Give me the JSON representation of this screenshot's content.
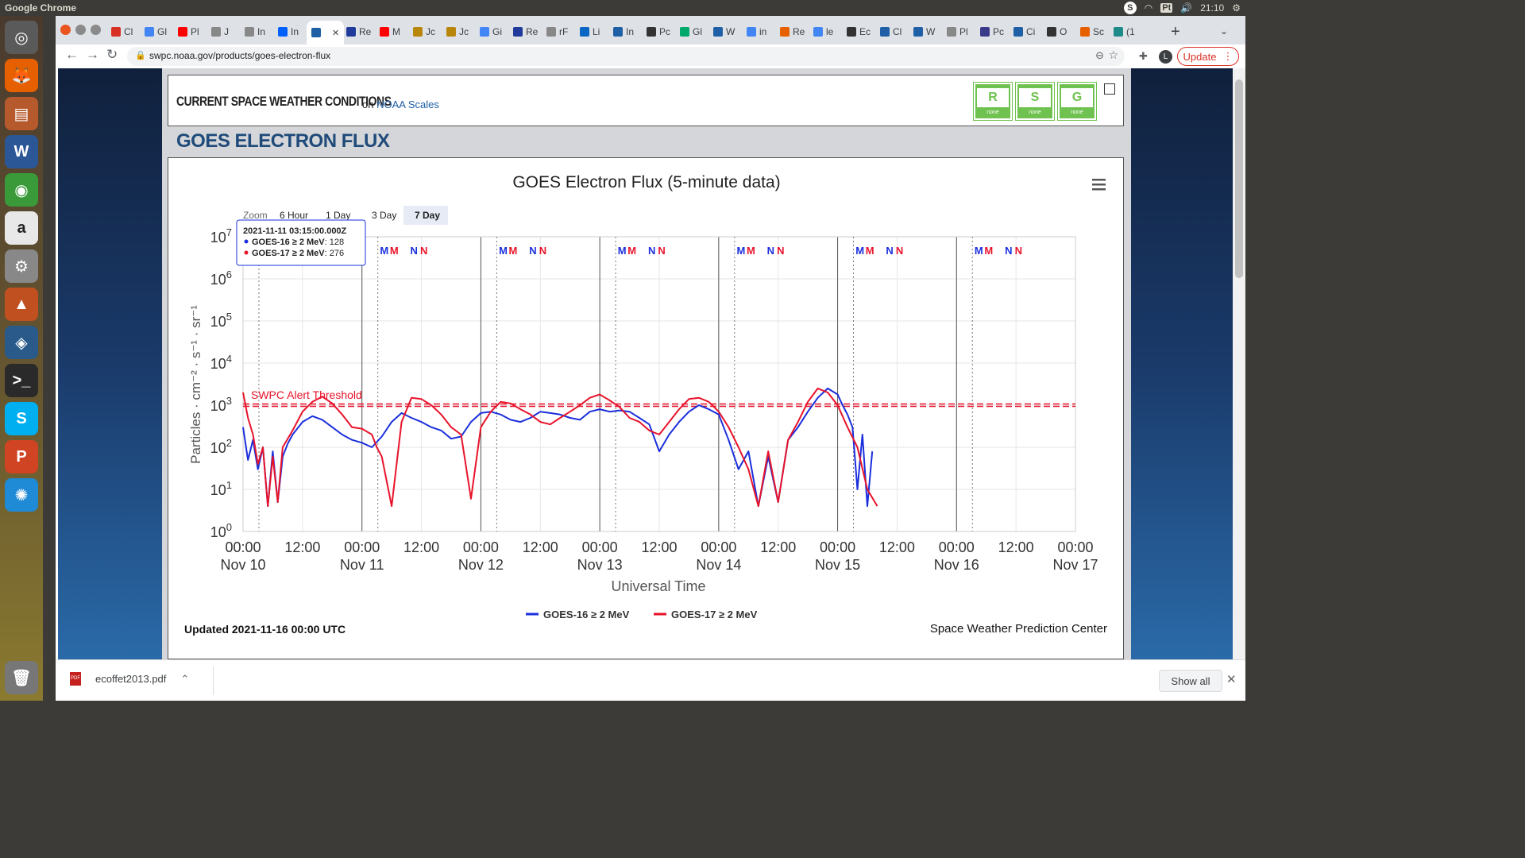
{
  "os": {
    "app_title": "Google Chrome",
    "tray": {
      "skype": "S",
      "keyboard": "Pt",
      "time": "21:10"
    }
  },
  "launcher": [
    {
      "name": "dash-icon",
      "color": "#5a5a5a",
      "glyph": "◎"
    },
    {
      "name": "firefox-icon",
      "color": "#e66000",
      "glyph": "🦊"
    },
    {
      "name": "files-icon",
      "color": "#b65a2e",
      "glyph": "▤"
    },
    {
      "name": "word-icon",
      "color": "#2b5797",
      "glyph": "W"
    },
    {
      "name": "chrome-icon",
      "color": "#3a9a3a",
      "glyph": "◉"
    },
    {
      "name": "amazon-icon",
      "color": "#e8e8e8",
      "glyph": "a"
    },
    {
      "name": "settings-icon",
      "color": "#888",
      "glyph": "⚙"
    },
    {
      "name": "matlab-icon",
      "color": "#c05020",
      "glyph": "▲"
    },
    {
      "name": "globe-app-icon",
      "color": "#2a5a8a",
      "glyph": "◈"
    },
    {
      "name": "terminal-icon",
      "color": "#2a2a2a",
      "glyph": ">_"
    },
    {
      "name": "skype-icon",
      "color": "#00aff0",
      "glyph": "S"
    },
    {
      "name": "powerpoint-icon",
      "color": "#d04423",
      "glyph": "P"
    },
    {
      "name": "weather-app-icon",
      "color": "#1f8ad6",
      "glyph": "✺"
    },
    {
      "name": "trash-icon",
      "color": "#777",
      "glyph": "🗑"
    }
  ],
  "browser": {
    "tabs": [
      {
        "label": "Cl",
        "color": "#d93025"
      },
      {
        "label": "Gl",
        "color": "#4285f4"
      },
      {
        "label": "Pl",
        "color": "#ff0000"
      },
      {
        "label": "J",
        "color": "#888"
      },
      {
        "label": "In",
        "color": "#888"
      },
      {
        "label": "In",
        "color": "#0061fe"
      },
      {
        "label": "",
        "color": "#1f5fa6",
        "active": true
      },
      {
        "label": "Re",
        "color": "#1f3a9a"
      },
      {
        "label": "M",
        "color": "#ff0000"
      },
      {
        "label": "Jc",
        "color": "#b8860b"
      },
      {
        "label": "Jc",
        "color": "#b8860b"
      },
      {
        "label": "Gi",
        "color": "#4285f4"
      },
      {
        "label": "Re",
        "color": "#1f3a9a"
      },
      {
        "label": "rF",
        "color": "#888"
      },
      {
        "label": "Li",
        "color": "#0a66c2"
      },
      {
        "label": "In",
        "color": "#1f5fa6"
      },
      {
        "label": "Pc",
        "color": "#333"
      },
      {
        "label": "Gl",
        "color": "#00a86b"
      },
      {
        "label": "W",
        "color": "#1f5fa6"
      },
      {
        "label": "in",
        "color": "#4285f4"
      },
      {
        "label": "Re",
        "color": "#e66000"
      },
      {
        "label": "le",
        "color": "#4285f4"
      },
      {
        "label": "Ec",
        "color": "#333"
      },
      {
        "label": "Cl",
        "color": "#1f5fa6"
      },
      {
        "label": "W",
        "color": "#1f5fa6"
      },
      {
        "label": "Pl",
        "color": "#888"
      },
      {
        "label": "Pc",
        "color": "#3a3a8a"
      },
      {
        "label": "Ci",
        "color": "#1f5fa6"
      },
      {
        "label": "O",
        "color": "#333"
      },
      {
        "label": "Sc",
        "color": "#e66000"
      },
      {
        "label": "(1",
        "color": "#1f8a8a"
      }
    ],
    "url": "swpc.noaa.gov/products/goes-electron-flux",
    "update_label": "Update"
  },
  "page": {
    "banner_title": "CURRENT SPACE WEATHER CONDITIONS",
    "banner_on": "on",
    "banner_link": "NOAA Scales",
    "scales": [
      {
        "letter": "R",
        "level": "none"
      },
      {
        "letter": "S",
        "level": "none"
      },
      {
        "letter": "G",
        "level": "none"
      }
    ],
    "heading": "GOES ELECTRON FLUX"
  },
  "chart": {
    "title": "GOES Electron Flux (5-minute data)",
    "zoom_label": "Zoom",
    "zoom_buttons": [
      "6 Hour",
      "1 Day",
      "3 Day",
      "7 Day"
    ],
    "zoom_selected": "7 Day",
    "ylabel": "Particles · cm⁻² · s⁻¹ · sr⁻¹",
    "xlabel": "Universal Time",
    "threshold_label": "SWPC Alert Threshold",
    "tooltip": {
      "time": "2021-11-11 03:15:00.000Z",
      "rows": [
        {
          "name": "GOES-16 ≥ 2 MeV",
          "value": "128",
          "color": "#1a2fdc"
        },
        {
          "name": "GOES-17 ≥ 2 MeV",
          "value": "276",
          "color": "#e8132a"
        }
      ]
    },
    "updated": "Updated 2021-11-16 00:00 UTC",
    "credit": "Space Weather Prediction Center",
    "mn_markers": [
      "M",
      "M",
      "N",
      "N"
    ]
  },
  "chart_data": {
    "type": "line",
    "title": "GOES Electron Flux (5-minute data)",
    "xlabel": "Universal Time",
    "ylabel": "Particles · cm⁻² · s⁻¹ · sr⁻¹",
    "yscale": "log",
    "ylim": [
      1,
      10000000
    ],
    "xlim": [
      "2021-11-10T00:00Z",
      "2021-11-17T00:00Z"
    ],
    "x_ticks": [
      {
        "time": "00:00",
        "date": "Nov 10"
      },
      {
        "time": "12:00",
        "date": ""
      },
      {
        "time": "00:00",
        "date": "Nov 11"
      },
      {
        "time": "12:00",
        "date": ""
      },
      {
        "time": "00:00",
        "date": "Nov 12"
      },
      {
        "time": "12:00",
        "date": ""
      },
      {
        "time": "00:00",
        "date": "Nov 13"
      },
      {
        "time": "12:00",
        "date": ""
      },
      {
        "time": "00:00",
        "date": "Nov 14"
      },
      {
        "time": "12:00",
        "date": ""
      },
      {
        "time": "00:00",
        "date": "Nov 15"
      },
      {
        "time": "12:00",
        "date": ""
      },
      {
        "time": "00:00",
        "date": "Nov 16"
      },
      {
        "time": "12:00",
        "date": ""
      },
      {
        "time": "00:00",
        "date": "Nov 17"
      }
    ],
    "y_ticks": [
      {
        "base": "10",
        "exp": "0"
      },
      {
        "base": "10",
        "exp": "1"
      },
      {
        "base": "10",
        "exp": "2"
      },
      {
        "base": "10",
        "exp": "3"
      },
      {
        "base": "10",
        "exp": "4"
      },
      {
        "base": "10",
        "exp": "5"
      },
      {
        "base": "10",
        "exp": "6"
      },
      {
        "base": "10",
        "exp": "7"
      }
    ],
    "threshold": 1000,
    "grid": true,
    "legend": "bottom-center",
    "series": [
      {
        "name": "GOES-16 ≥ 2 MeV",
        "color": "#1a2fdc",
        "hours": [
          0,
          1,
          2,
          3,
          4,
          5,
          6,
          7,
          8,
          9,
          10,
          12,
          14,
          16,
          18,
          20,
          22,
          24,
          26,
          28,
          30,
          32,
          34,
          36,
          38,
          40,
          42,
          44,
          46,
          48,
          50,
          52,
          54,
          56,
          58,
          60,
          62,
          64,
          66,
          68,
          70,
          72,
          74,
          76,
          78,
          80,
          82,
          84,
          86,
          88,
          90,
          92,
          94,
          96,
          98,
          100,
          102,
          104,
          106,
          108,
          110,
          112,
          114,
          116,
          118,
          120,
          121,
          122,
          123,
          124,
          125,
          126,
          127,
          128,
          130,
          132,
          134,
          135,
          136,
          137,
          138,
          139,
          140,
          141,
          142,
          143,
          144
        ],
        "values": [
          300,
          50,
          150,
          30,
          100,
          4,
          80,
          5,
          60,
          120,
          200,
          400,
          550,
          450,
          300,
          200,
          150,
          128,
          100,
          180,
          400,
          650,
          500,
          400,
          300,
          250,
          160,
          180,
          400,
          650,
          700,
          600,
          450,
          400,
          500,
          700,
          650,
          600,
          500,
          450,
          700,
          800,
          700,
          750,
          700,
          500,
          350,
          80,
          200,
          400,
          700,
          1000,
          800,
          600,
          150,
          30,
          80,
          4,
          60,
          5,
          150,
          300,
          700,
          1500,
          2500,
          1800,
          1000,
          600,
          300,
          10,
          200,
          4,
          80
        ]
      },
      {
        "name": "GOES-17 ≥ 2 MeV",
        "color": "#e8132a",
        "hours": [
          0,
          1,
          2,
          3,
          4,
          5,
          6,
          7,
          8,
          10,
          12,
          14,
          16,
          18,
          20,
          22,
          24,
          26,
          27,
          28,
          30,
          32,
          34,
          36,
          38,
          40,
          42,
          44,
          46,
          48,
          50,
          52,
          54,
          56,
          58,
          60,
          62,
          64,
          66,
          68,
          70,
          72,
          74,
          76,
          78,
          80,
          82,
          84,
          86,
          88,
          90,
          92,
          94,
          96,
          98,
          100,
          102,
          104,
          106,
          108,
          110,
          112,
          114,
          116,
          118,
          120,
          122,
          124,
          126,
          128,
          130,
          132,
          134,
          135,
          136,
          137,
          138,
          139,
          140,
          141,
          142,
          143,
          144
        ],
        "values": [
          2000,
          500,
          200,
          40,
          100,
          4,
          60,
          5,
          100,
          250,
          700,
          1200,
          1600,
          1100,
          600,
          300,
          276,
          200,
          100,
          60,
          4,
          400,
          1500,
          1400,
          1000,
          600,
          300,
          200,
          6,
          300,
          700,
          1200,
          1100,
          800,
          600,
          400,
          350,
          500,
          700,
          1000,
          1500,
          1800,
          1300,
          900,
          500,
          400,
          250,
          200,
          400,
          800,
          1400,
          1500,
          1200,
          700,
          300,
          100,
          30,
          4,
          80,
          5,
          150,
          400,
          1200,
          2500,
          2000,
          1000,
          300,
          100,
          10,
          4
        ]
      }
    ]
  },
  "downloads": {
    "file": "ecoffet2013.pdf",
    "show_all": "Show all"
  }
}
